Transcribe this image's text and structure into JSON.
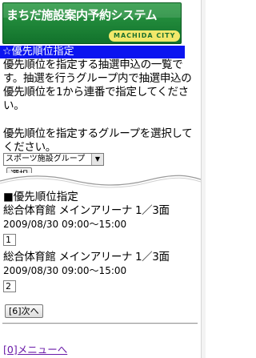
{
  "header": {
    "site_title": "まちだ施設案内予約システム",
    "city_label": "MACHIDA CITY"
  },
  "page": {
    "heading": "☆優先順位指定",
    "description": "優先順位を指定する抽選申込の一覧です。抽選を行うグループ内で抽選申込の優先順位を1から連番で指定してください。",
    "group_prompt": "優先順位を指定するグループを選択してください。",
    "group_select_value": "スポーツ施設グループ",
    "select_button": "選択"
  },
  "priority": {
    "section_title": "■優先順位指定",
    "records": [
      {
        "facility": "総合体育館 メインアリーナ 1／3面",
        "datetime": "2009/08/30 09:00～15:00",
        "priority": "1"
      },
      {
        "facility": "総合体育館 メインアリーナ 1／3面",
        "datetime": "2009/08/30 09:00～15:00",
        "priority": "2"
      }
    ],
    "next_button": "[6]次へ"
  },
  "footer": {
    "menu_link": "[0]メニューへ"
  },
  "colors": {
    "banner_green": "#1a8a3a",
    "heading_blue": "#0b14f0",
    "link_visited": "#6a1aa8"
  }
}
